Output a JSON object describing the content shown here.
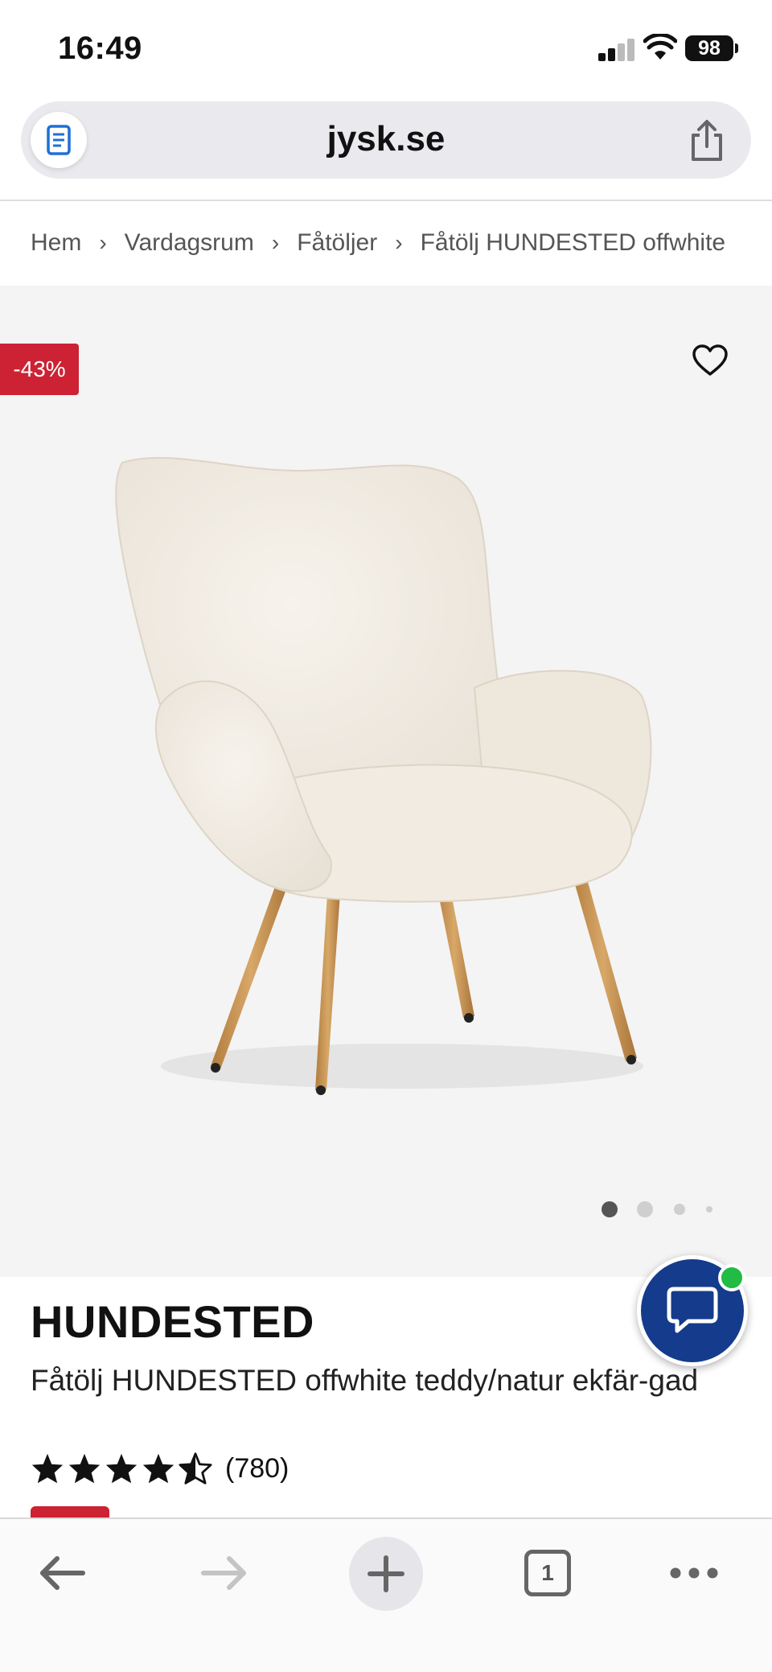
{
  "status_bar": {
    "time": "16:49",
    "battery": "98",
    "signal_icon": "cellular-signal-icon",
    "wifi_icon": "wifi-icon"
  },
  "browser": {
    "url": "jysk.se",
    "reader_icon": "reader-mode-icon",
    "share_icon": "share-icon"
  },
  "breadcrumb": [
    "Hem",
    "Vardagsrum",
    "Fåtöljer",
    "Fåtölj HUNDESTED offwhite"
  ],
  "product": {
    "discount": "-43%",
    "name": "HUNDESTED",
    "description": "Fåtölj HUNDESTED offwhite teddy/natur ekfär-gad",
    "rating": 4.5,
    "rating_count": "(780)",
    "image_count": 4,
    "active_image": 1,
    "favorite_icon": "heart-outline-icon",
    "image_icon": "armchair-image"
  },
  "chat": {
    "icon": "chat-bubble-icon",
    "status": "online"
  },
  "toolbar": {
    "back_icon": "arrow-left-icon",
    "forward_icon": "arrow-right-icon",
    "new_tab_icon": "plus-icon",
    "tab_count": "1",
    "more_icon": "more-icon"
  },
  "colors": {
    "brand_red": "#cc2233",
    "chat_blue": "#143b8c",
    "online_green": "#22bb44"
  }
}
